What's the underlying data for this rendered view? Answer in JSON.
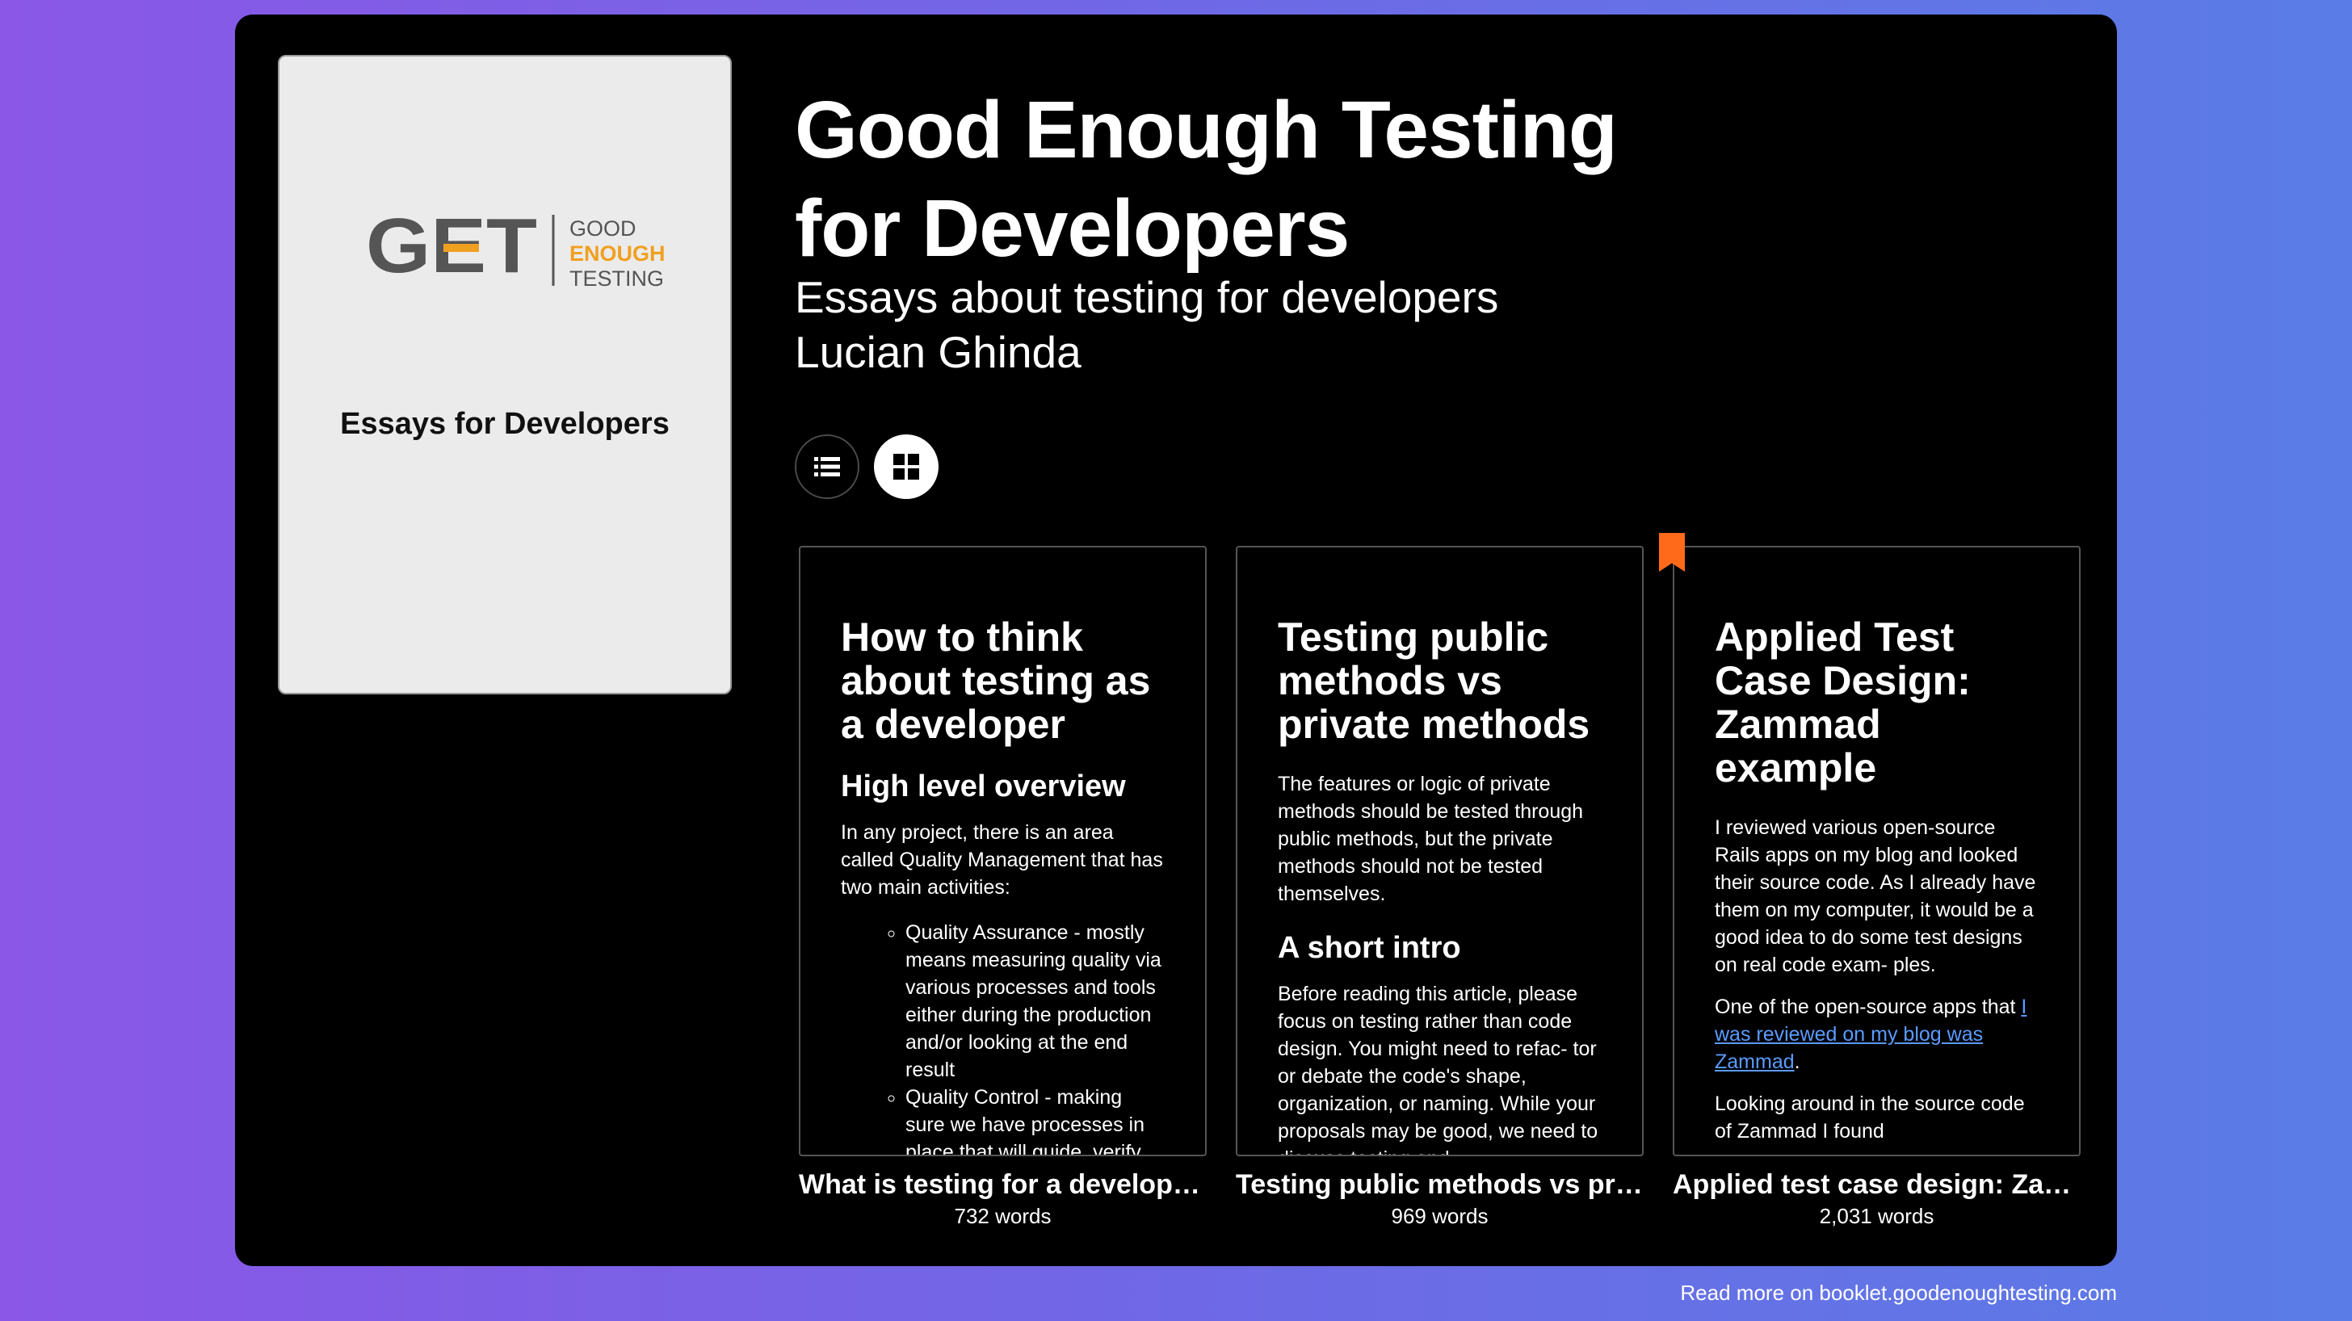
{
  "cover": {
    "logo_mark": "GET",
    "logo_words": [
      "GOOD",
      "ENOUGH",
      "TESTING"
    ],
    "subtitle": "Essays for Developers",
    "colors": {
      "logo_gray": "#555555",
      "logo_accent": "#f0a020"
    }
  },
  "book": {
    "title_line1": "Good Enough Testing",
    "title_line2": "for Developers",
    "subtitle": "Essays about testing for developers",
    "author": "Lucian Ghinda"
  },
  "view_toggle": {
    "list_icon": "list-icon",
    "grid_icon": "grid-icon",
    "selected": "grid"
  },
  "cards": [
    {
      "heading": "How to think about testing as a developer",
      "subheading": "High level overview",
      "intro": "In any project, there is an area called Quality Management that has two main activities:",
      "bullets": [
        "Quality Assurance - mostly means measuring quality via various processes and tools either during the production and/or looking at the end result",
        "Quality Control - making sure we have processes in place that will guide, verify"
      ],
      "caption": "What is testing for a developer?",
      "words": "732 words"
    },
    {
      "heading": "Testing public methods vs private methods",
      "intro": "The features or logic of private methods should be tested through public methods, but the private methods should not be tested themselves.",
      "subheading": "A short intro",
      "body": "Before reading this article, please focus on testing rather than code design. You might need to refac- tor or debate the code's shape, organization, or naming. While your proposals may be good, we need to discuss testing and",
      "caption": "Testing public methods vs priv...",
      "words": "969 words"
    },
    {
      "heading": "Applied Test Case Design: Zammad example",
      "intro": "I reviewed various open-source Rails apps on my blog and looked their source code. As I already have them on my computer, it would be a good idea to do some test designs on real code exam- ples.",
      "p2_before": "One of the open-source apps that ",
      "p2_link": "I was reviewed on my blog was Zammad",
      "p2_after": ".",
      "p3": "Looking around in the source code of Zammad I found",
      "caption": "Applied test case design: Zam...",
      "words": "2,031 words",
      "bookmarked": true,
      "bookmark_color": "#ff6a1a"
    }
  ],
  "footer": {
    "text": "Read more on booklet.goodenoughtesting.com"
  }
}
